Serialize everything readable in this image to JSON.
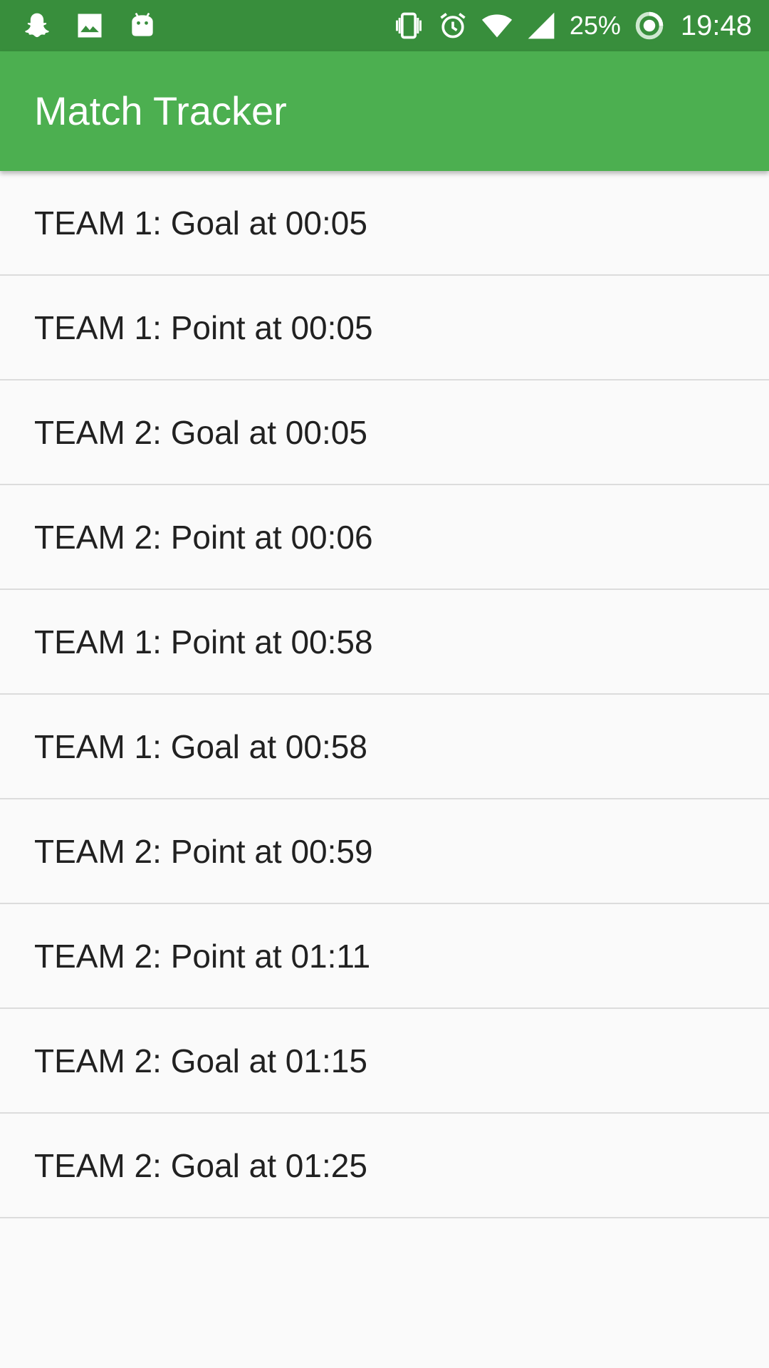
{
  "status_bar": {
    "icons_left": [
      "snapchat-icon",
      "image-icon",
      "android-icon"
    ],
    "icons_right": [
      "vibrate-icon",
      "alarm-icon",
      "wifi-icon",
      "signal-icon",
      "battery-saver-icon"
    ],
    "battery": "25%",
    "time": "19:48"
  },
  "app_bar": {
    "title": "Match Tracker",
    "color": "#4caf50",
    "status_color": "#388e3c"
  },
  "events": [
    {
      "label": "TEAM 1: Goal at 00:05"
    },
    {
      "label": "TEAM 1: Point at 00:05"
    },
    {
      "label": "TEAM 2: Goal at 00:05"
    },
    {
      "label": "TEAM 2: Point at 00:06"
    },
    {
      "label": "TEAM 1: Point at 00:58"
    },
    {
      "label": "TEAM 1: Goal at 00:58"
    },
    {
      "label": "TEAM 2: Point at 00:59"
    },
    {
      "label": "TEAM 2: Point at 01:11"
    },
    {
      "label": "TEAM 2: Goal at 01:15"
    },
    {
      "label": "TEAM 2: Goal at 01:25"
    }
  ]
}
